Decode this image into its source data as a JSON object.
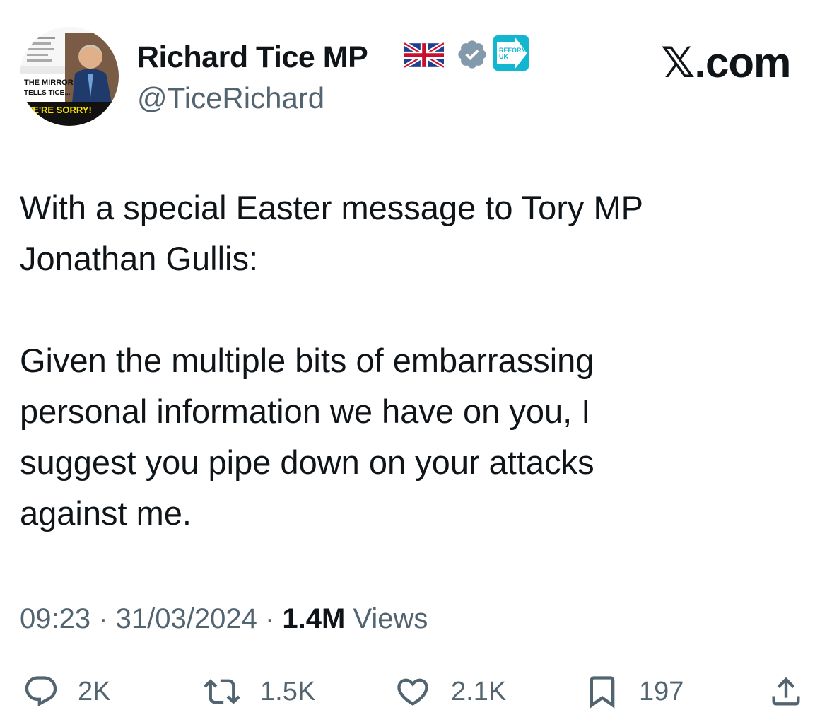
{
  "profile": {
    "display_name": "Richard Tice MP",
    "handle": "@TiceRichard",
    "badges": [
      "uk-flag-icon",
      "verified-icon",
      "reform-uk-icon"
    ],
    "party_badge_text": [
      "REFORM",
      "UK"
    ],
    "avatar_text": [
      "THE MIRROR",
      "TELLS TICE...",
      "WE'RE SORRY!"
    ]
  },
  "site_label": "𝕏.com",
  "tweet": {
    "text": "With a special Easter message to Tory MP\nJonathan Gullis:\n\nGiven the multiple bits of embarrassing\npersonal information we have on you, I\nsuggest you pipe down on your attacks\nagainst me."
  },
  "meta": {
    "time": "09:23",
    "separator": " · ",
    "date": "31/03/2024",
    "views_count": "1.4M",
    "views_label": " Views"
  },
  "actions": {
    "reply": "2K",
    "retweet": "1.5K",
    "like": "2.1K",
    "bookmark": "197"
  },
  "colors": {
    "text": "#0f1419",
    "muted": "#536471",
    "verified": "#829aab",
    "reform": "#12b6cf"
  }
}
